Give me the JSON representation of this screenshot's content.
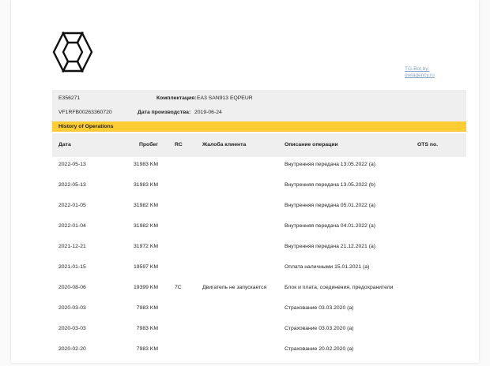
{
  "header": {
    "tg_link": "TG-Bot by: owlagency.ru"
  },
  "vehicle": {
    "code": "E356271",
    "trim_label": "Комплектация:",
    "trim_value": "EA3   SAN913 EQPEUR",
    "vin": "VF1RFB00263360720",
    "prod_label": "Дата производства:",
    "prod_value": "2019-06-24"
  },
  "section_title": "History of Operations",
  "table": {
    "headers": {
      "date": "Дата",
      "mileage": "Пробег",
      "rc": "RC",
      "complaint": "Жалоба клиента",
      "description": "Описание операции",
      "ots": "OTS no."
    },
    "rows": [
      {
        "date": "2022-05-13",
        "mileage": "31983 KM",
        "rc": "",
        "complaint": "",
        "description": "Внутренняя передача 13.05.2022 (a)",
        "ots": ""
      },
      {
        "date": "2022-05-13",
        "mileage": "31983 KM",
        "rc": "",
        "complaint": "",
        "description": "Внутренняя передача 13.05.2022 (b)",
        "ots": ""
      },
      {
        "date": "2022-01-05",
        "mileage": "31982 KM",
        "rc": "",
        "complaint": "",
        "description": "Внутренняя передача 05.01.2022 (a)",
        "ots": ""
      },
      {
        "date": "2022-01-04",
        "mileage": "31982 KM",
        "rc": "",
        "complaint": "",
        "description": "Внутренняя передача 04.01.2022 (a)",
        "ots": ""
      },
      {
        "date": "2021-12-21",
        "mileage": "31972 KM",
        "rc": "",
        "complaint": "",
        "description": "Внутренняя передача 21.12.2021 (a)",
        "ots": ""
      },
      {
        "date": "2021-01-15",
        "mileage": "19597 KM",
        "rc": "",
        "complaint": "",
        "description": "Оплата наличными 15.01.2021 (a)",
        "ots": ""
      },
      {
        "date": "2020-08-06",
        "mileage": "19399 KM",
        "rc": "7C",
        "complaint": "Двигатель не запускается",
        "description": "Блок и плата, соединения, предохранители",
        "ots": ""
      },
      {
        "date": "2020-03-03",
        "mileage": "7983 KM",
        "rc": "",
        "complaint": "",
        "description": "Страхование 03.03.2020 (a)",
        "ots": ""
      },
      {
        "date": "2020-03-03",
        "mileage": "7983 KM",
        "rc": "",
        "complaint": "",
        "description": "Страхование 03.03.2020 (a)",
        "ots": ""
      },
      {
        "date": "2020-02-20",
        "mileage": "7983 KM",
        "rc": "",
        "complaint": "",
        "description": "Страхование 20.02.2020 (a)",
        "ots": ""
      }
    ]
  },
  "colors": {
    "section_bar": "#ffcc33",
    "info_bg": "#efefef",
    "link": "#8aa4c8"
  }
}
